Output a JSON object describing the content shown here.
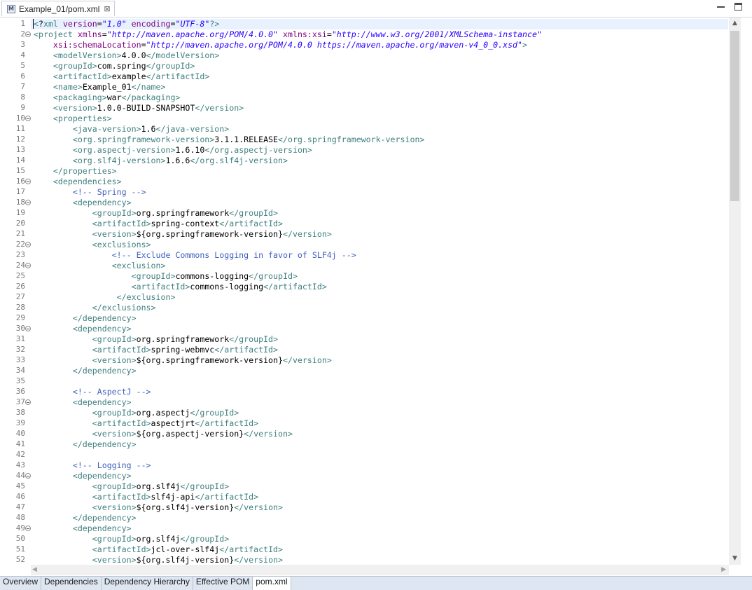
{
  "editor_tab": {
    "label": "Example_01/pom.xml",
    "icon": "maven-file-icon",
    "icon_glyph": "M"
  },
  "window_buttons": [
    "minimize",
    "maximize"
  ],
  "gutter": {
    "fold_markers": [
      2,
      10,
      16,
      18,
      22,
      24,
      30,
      37,
      44,
      49
    ]
  },
  "code_lines": [
    [
      [
        "t",
        "<"
      ],
      [
        "n",
        "?"
      ],
      [
        "t",
        "xml "
      ],
      [
        "a",
        "version"
      ],
      [
        "n",
        "="
      ],
      [
        "v",
        "\"1.0\""
      ],
      [
        "n",
        " "
      ],
      [
        "a",
        "encoding"
      ],
      [
        "n",
        "="
      ],
      [
        "v",
        "\"UTF-8\""
      ],
      [
        "t",
        "?>"
      ]
    ],
    [
      [
        "t",
        "<project "
      ],
      [
        "a",
        "xmlns"
      ],
      [
        "n",
        "="
      ],
      [
        "v",
        "\"http://maven.apache.org/POM/4.0.0\""
      ],
      [
        "n",
        " "
      ],
      [
        "a",
        "xmlns:xsi"
      ],
      [
        "n",
        "="
      ],
      [
        "v",
        "\"http://www.w3.org/2001/XMLSchema-instance\""
      ]
    ],
    [
      [
        "n",
        "    "
      ],
      [
        "a",
        "xsi:schemaLocation"
      ],
      [
        "n",
        "="
      ],
      [
        "v",
        "\"http://maven.apache.org/POM/4.0.0 https://maven.apache.org/maven-v4_0_0.xsd\""
      ],
      [
        "t",
        ">"
      ]
    ],
    [
      [
        "n",
        "    "
      ],
      [
        "t",
        "<modelVersion>"
      ],
      [
        "n",
        "4.0.0"
      ],
      [
        "t",
        "</modelVersion>"
      ]
    ],
    [
      [
        "n",
        "    "
      ],
      [
        "t",
        "<groupId>"
      ],
      [
        "n",
        "com.spring"
      ],
      [
        "t",
        "</groupId>"
      ]
    ],
    [
      [
        "n",
        "    "
      ],
      [
        "t",
        "<artifactId>"
      ],
      [
        "n",
        "example"
      ],
      [
        "t",
        "</artifactId>"
      ]
    ],
    [
      [
        "n",
        "    "
      ],
      [
        "t",
        "<name>"
      ],
      [
        "n",
        "Example_01"
      ],
      [
        "t",
        "</name>"
      ]
    ],
    [
      [
        "n",
        "    "
      ],
      [
        "t",
        "<packaging>"
      ],
      [
        "n",
        "war"
      ],
      [
        "t",
        "</packaging>"
      ]
    ],
    [
      [
        "n",
        "    "
      ],
      [
        "t",
        "<version>"
      ],
      [
        "n",
        "1.0.0-BUILD-SNAPSHOT"
      ],
      [
        "t",
        "</version>"
      ]
    ],
    [
      [
        "n",
        "    "
      ],
      [
        "t",
        "<properties>"
      ]
    ],
    [
      [
        "n",
        "        "
      ],
      [
        "t",
        "<java-version>"
      ],
      [
        "n",
        "1.6"
      ],
      [
        "t",
        "</java-version>"
      ]
    ],
    [
      [
        "n",
        "        "
      ],
      [
        "t",
        "<org.springframework-version>"
      ],
      [
        "n",
        "3.1.1.RELEASE"
      ],
      [
        "t",
        "</org.springframework-version>"
      ]
    ],
    [
      [
        "n",
        "        "
      ],
      [
        "t",
        "<org.aspectj-version>"
      ],
      [
        "n",
        "1.6.10"
      ],
      [
        "t",
        "</org.aspectj-version>"
      ]
    ],
    [
      [
        "n",
        "        "
      ],
      [
        "t",
        "<org.slf4j-version>"
      ],
      [
        "n",
        "1.6.6"
      ],
      [
        "t",
        "</org.slf4j-version>"
      ]
    ],
    [
      [
        "n",
        "    "
      ],
      [
        "t",
        "</properties>"
      ]
    ],
    [
      [
        "n",
        "    "
      ],
      [
        "t",
        "<dependencies>"
      ]
    ],
    [
      [
        "n",
        "        "
      ],
      [
        "c",
        "<!-- Spring -->"
      ]
    ],
    [
      [
        "n",
        "        "
      ],
      [
        "t",
        "<dependency>"
      ]
    ],
    [
      [
        "n",
        "            "
      ],
      [
        "t",
        "<groupId>"
      ],
      [
        "n",
        "org.springframework"
      ],
      [
        "t",
        "</groupId>"
      ]
    ],
    [
      [
        "n",
        "            "
      ],
      [
        "t",
        "<artifactId>"
      ],
      [
        "n",
        "spring-context"
      ],
      [
        "t",
        "</artifactId>"
      ]
    ],
    [
      [
        "n",
        "            "
      ],
      [
        "t",
        "<version>"
      ],
      [
        "n",
        "${org.springframework-version}"
      ],
      [
        "t",
        "</version>"
      ]
    ],
    [
      [
        "n",
        "            "
      ],
      [
        "t",
        "<exclusions>"
      ]
    ],
    [
      [
        "n",
        "                "
      ],
      [
        "c",
        "<!-- Exclude Commons Logging in favor of SLF4j -->"
      ]
    ],
    [
      [
        "n",
        "                "
      ],
      [
        "t",
        "<exclusion>"
      ]
    ],
    [
      [
        "n",
        "                    "
      ],
      [
        "t",
        "<groupId>"
      ],
      [
        "n",
        "commons-logging"
      ],
      [
        "t",
        "</groupId>"
      ]
    ],
    [
      [
        "n",
        "                    "
      ],
      [
        "t",
        "<artifactId>"
      ],
      [
        "n",
        "commons-logging"
      ],
      [
        "t",
        "</artifactId>"
      ]
    ],
    [
      [
        "n",
        "                 "
      ],
      [
        "t",
        "</exclusion>"
      ]
    ],
    [
      [
        "n",
        "            "
      ],
      [
        "t",
        "</exclusions>"
      ]
    ],
    [
      [
        "n",
        "        "
      ],
      [
        "t",
        "</dependency>"
      ]
    ],
    [
      [
        "n",
        "        "
      ],
      [
        "t",
        "<dependency>"
      ]
    ],
    [
      [
        "n",
        "            "
      ],
      [
        "t",
        "<groupId>"
      ],
      [
        "n",
        "org.springframework"
      ],
      [
        "t",
        "</groupId>"
      ]
    ],
    [
      [
        "n",
        "            "
      ],
      [
        "t",
        "<artifactId>"
      ],
      [
        "n",
        "spring-webmvc"
      ],
      [
        "t",
        "</artifactId>"
      ]
    ],
    [
      [
        "n",
        "            "
      ],
      [
        "t",
        "<version>"
      ],
      [
        "n",
        "${org.springframework-version}"
      ],
      [
        "t",
        "</version>"
      ]
    ],
    [
      [
        "n",
        "        "
      ],
      [
        "t",
        "</dependency>"
      ]
    ],
    [],
    [
      [
        "n",
        "        "
      ],
      [
        "c",
        "<!-- AspectJ -->"
      ]
    ],
    [
      [
        "n",
        "        "
      ],
      [
        "t",
        "<dependency>"
      ]
    ],
    [
      [
        "n",
        "            "
      ],
      [
        "t",
        "<groupId>"
      ],
      [
        "n",
        "org.aspectj"
      ],
      [
        "t",
        "</groupId>"
      ]
    ],
    [
      [
        "n",
        "            "
      ],
      [
        "t",
        "<artifactId>"
      ],
      [
        "n",
        "aspectjrt"
      ],
      [
        "t",
        "</artifactId>"
      ]
    ],
    [
      [
        "n",
        "            "
      ],
      [
        "t",
        "<version>"
      ],
      [
        "n",
        "${org.aspectj-version}"
      ],
      [
        "t",
        "</version>"
      ]
    ],
    [
      [
        "n",
        "        "
      ],
      [
        "t",
        "</dependency>"
      ]
    ],
    [],
    [
      [
        "n",
        "        "
      ],
      [
        "c",
        "<!-- Logging -->"
      ]
    ],
    [
      [
        "n",
        "        "
      ],
      [
        "t",
        "<dependency>"
      ]
    ],
    [
      [
        "n",
        "            "
      ],
      [
        "t",
        "<groupId>"
      ],
      [
        "n",
        "org.slf4j"
      ],
      [
        "t",
        "</groupId>"
      ]
    ],
    [
      [
        "n",
        "            "
      ],
      [
        "t",
        "<artifactId>"
      ],
      [
        "n",
        "slf4j-api"
      ],
      [
        "t",
        "</artifactId>"
      ]
    ],
    [
      [
        "n",
        "            "
      ],
      [
        "t",
        "<version>"
      ],
      [
        "n",
        "${org.slf4j-version}"
      ],
      [
        "t",
        "</version>"
      ]
    ],
    [
      [
        "n",
        "        "
      ],
      [
        "t",
        "</dependency>"
      ]
    ],
    [
      [
        "n",
        "        "
      ],
      [
        "t",
        "<dependency>"
      ]
    ],
    [
      [
        "n",
        "            "
      ],
      [
        "t",
        "<groupId>"
      ],
      [
        "n",
        "org.slf4j"
      ],
      [
        "t",
        "</groupId>"
      ]
    ],
    [
      [
        "n",
        "            "
      ],
      [
        "t",
        "<artifactId>"
      ],
      [
        "n",
        "jcl-over-slf4j"
      ],
      [
        "t",
        "</artifactId>"
      ]
    ],
    [
      [
        "n",
        "            "
      ],
      [
        "t",
        "<version>"
      ],
      [
        "n",
        "${org.slf4j-version}"
      ],
      [
        "t",
        "</version>"
      ]
    ]
  ],
  "scrollbars": {
    "up": "▲",
    "down": "▼",
    "left": "◀",
    "right": "▶"
  },
  "bottom_tabs": [
    {
      "label": "Overview",
      "active": false
    },
    {
      "label": "Dependencies",
      "active": false
    },
    {
      "label": "Dependency Hierarchy",
      "active": false
    },
    {
      "label": "Effective POM",
      "active": false
    },
    {
      "label": "pom.xml",
      "active": true
    }
  ],
  "colors": {
    "tag": "#3f7f7f",
    "attribute": "#7f007f",
    "value": "#2a00ff",
    "comment": "#3f5fbf",
    "current_line": "#e8f2fe"
  }
}
